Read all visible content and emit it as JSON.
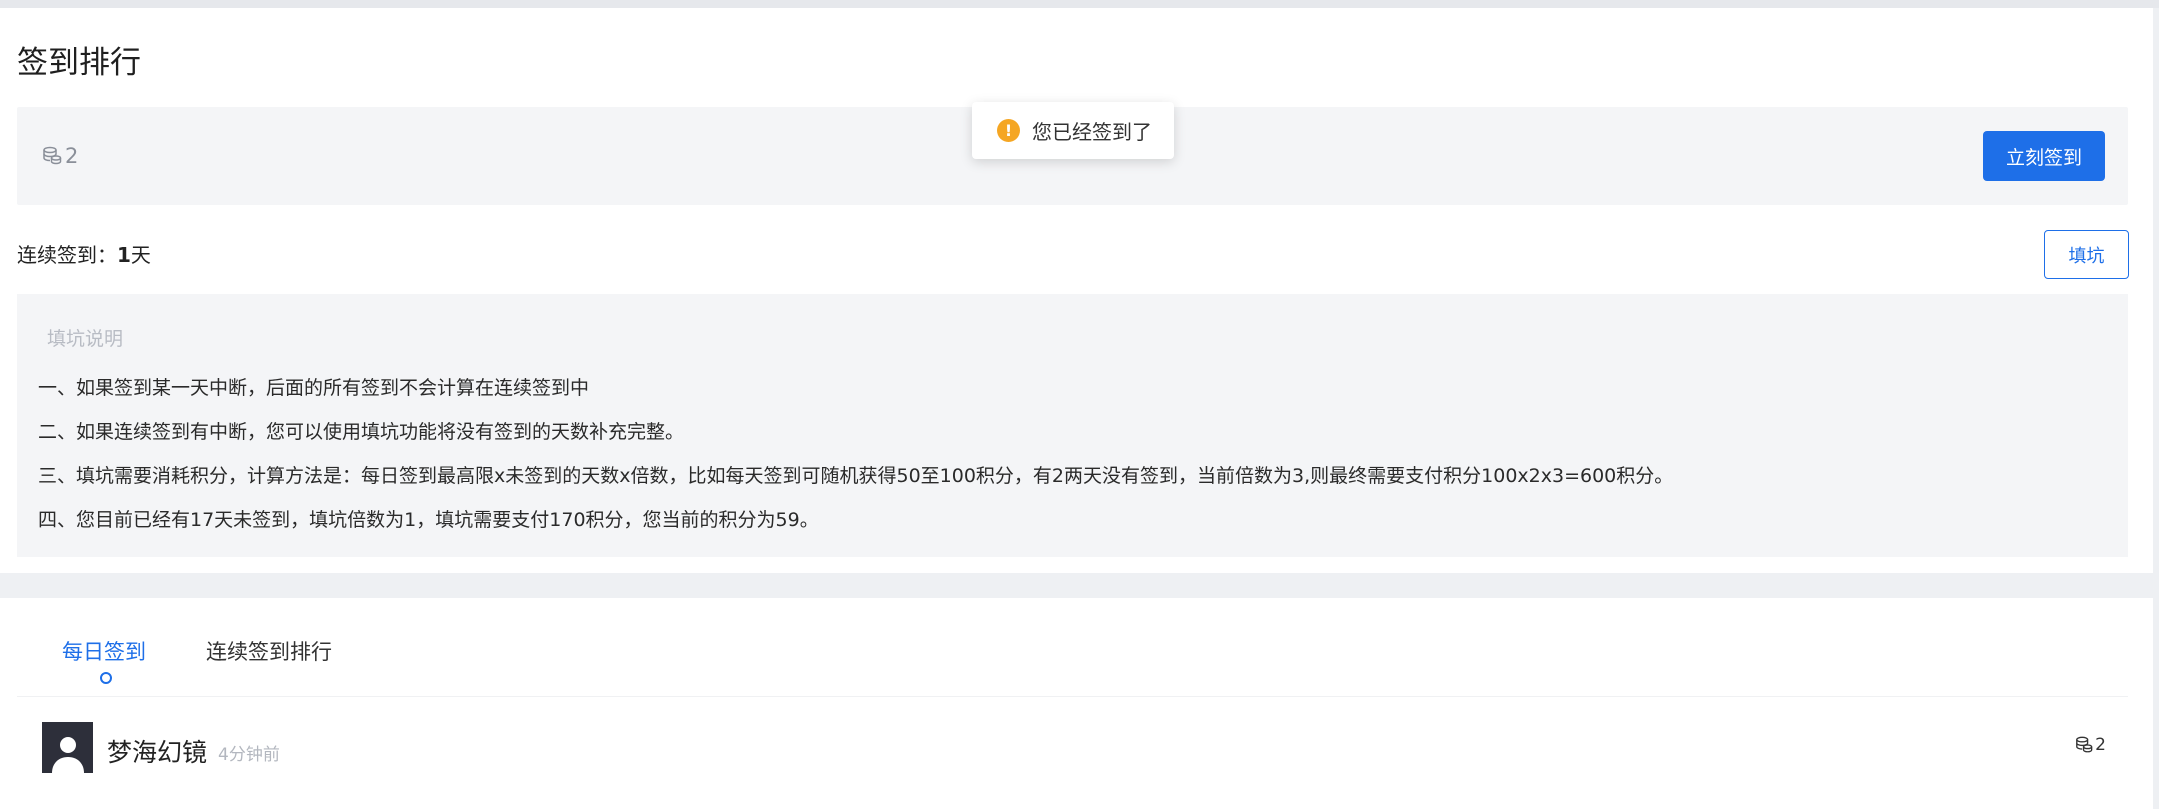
{
  "page": {
    "title": "签到排行"
  },
  "checkin": {
    "coins": "2",
    "button_label": "立刻签到"
  },
  "toast": {
    "message": "您已经签到了"
  },
  "streak": {
    "label": "连续签到：",
    "days": "1",
    "unit": "天",
    "fill_button_label": "填坑"
  },
  "notes": {
    "title": "填坑说明",
    "items": [
      "一、如果签到某一天中断，后面的所有签到不会计算在连续签到中",
      "二、如果连续签到有中断，您可以使用填坑功能将没有签到的天数补充完整。",
      "三、填坑需要消耗积分，计算方法是：每日签到最高限x未签到的天数x倍数，比如每天签到可随机获得50至100积分，有2两天没有签到，当前倍数为3,则最终需要支付积分100x2x3=600积分。",
      "四、您目前已经有17天未签到，填坑倍数为1，填坑需要支付170积分，您当前的积分为59。"
    ]
  },
  "tabs": [
    {
      "label": "每日签到",
      "active": true
    },
    {
      "label": "连续签到排行",
      "active": false
    }
  ],
  "ranking": [
    {
      "name": "梦海幻镜",
      "time": "4分钟前",
      "coins": "2"
    }
  ],
  "colors": {
    "accent": "#1e6fe8",
    "warning": "#f5a623",
    "panel_bg": "#f4f5f7"
  }
}
